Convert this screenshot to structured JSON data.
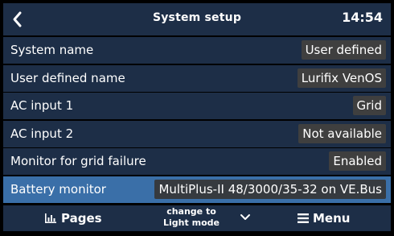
{
  "header": {
    "title": "System setup",
    "time": "14:54"
  },
  "rows": [
    {
      "label": "System name",
      "value": "User defined"
    },
    {
      "label": "User defined name",
      "value": "Lurifix VenOS"
    },
    {
      "label": "AC input 1",
      "value": "Grid"
    },
    {
      "label": "AC input 2",
      "value": "Not available"
    },
    {
      "label": "Monitor for grid failure",
      "value": "Enabled"
    },
    {
      "label": "Battery monitor",
      "value": "MultiPlus-II 48/3000/35-32 on VE.Bus",
      "selected": true
    }
  ],
  "footer": {
    "pages_label": "Pages",
    "mode_line1": "change to",
    "mode_line2": "Light mode",
    "menu_label": "Menu"
  },
  "icons": {
    "back": "chevron-left-icon",
    "pages": "bar-chart-icon",
    "mode": "chevron-down-icon",
    "menu": "hamburger-icon"
  },
  "colors": {
    "background": "#000000",
    "panel": "#1d2e47",
    "selected": "#3a6fa8",
    "value_box": "#3f3f3f",
    "text": "#ffffff"
  }
}
